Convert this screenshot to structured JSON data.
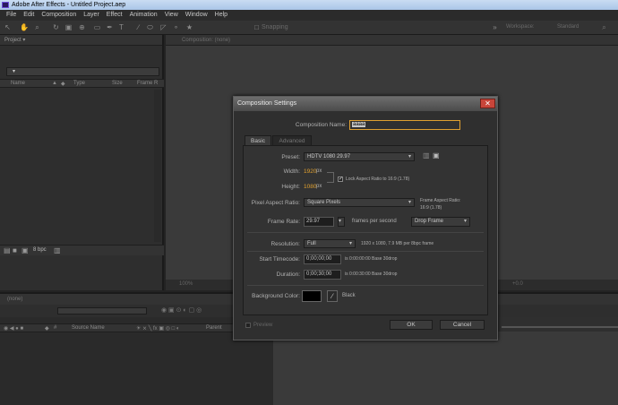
{
  "window": {
    "title": "Adobe After Effects - Untitled Project.aep"
  },
  "menu": [
    "File",
    "Edit",
    "Composition",
    "Layer",
    "Effect",
    "Animation",
    "View",
    "Window",
    "Help"
  ],
  "toolbar": {
    "snapping": "Snapping",
    "workspace_label": "Workspace:",
    "workspace_value": "Standard"
  },
  "project_panel": {
    "tab": "Project",
    "columns": [
      "Name",
      "Type",
      "Size",
      "Frame R"
    ],
    "bit_depth": "8 bpc"
  },
  "comp_panel": {
    "tab": "Composition: (none)",
    "zoom": "100%",
    "offset": "+0.0"
  },
  "timeline": {
    "tab": "(none)",
    "source_name_header": "Source Name",
    "parent_header": "Parent"
  },
  "dialog": {
    "title": "Composition Settings",
    "comp_name_label": "Composition Name:",
    "comp_name_value": "aaaa",
    "tabs": [
      "Basic",
      "Advanced"
    ],
    "preset_label": "Preset:",
    "preset_value": "HDTV 1080 29.97",
    "width_label": "Width:",
    "width_value": "1920",
    "height_label": "Height:",
    "height_value": "1080",
    "px_unit": "px",
    "lock_aspect": "Lock Aspect Ratio to 16:9 (1.78)",
    "par_label": "Pixel Aspect Ratio:",
    "par_value": "Square Pixels",
    "frame_aspect_title": "Frame Aspect Ratio:",
    "frame_aspect_value": "16:9 (1.78)",
    "frame_rate_label": "Frame Rate:",
    "frame_rate_value": "29.97",
    "fps_unit": "frames per second",
    "drop_frame": "Drop Frame",
    "resolution_label": "Resolution:",
    "resolution_value": "Full",
    "resolution_info": "1920 x 1080, 7.9 MB per 8bpc frame",
    "start_tc_label": "Start Timecode:",
    "start_tc_value": "0;00;00;00",
    "start_tc_info": "is 0:00:00:00  Base 30drop",
    "duration_label": "Duration:",
    "duration_value": "0;00;30;00",
    "duration_info": "is 0:00:30:00  Base 30drop",
    "bg_label": "Background Color:",
    "bg_color_name": "Black",
    "bg_color": "#000000",
    "preview_label": "Preview",
    "ok": "OK",
    "cancel": "Cancel"
  },
  "colors": {
    "accent_orange": "#e0a030",
    "close_red": "#c8453a"
  }
}
